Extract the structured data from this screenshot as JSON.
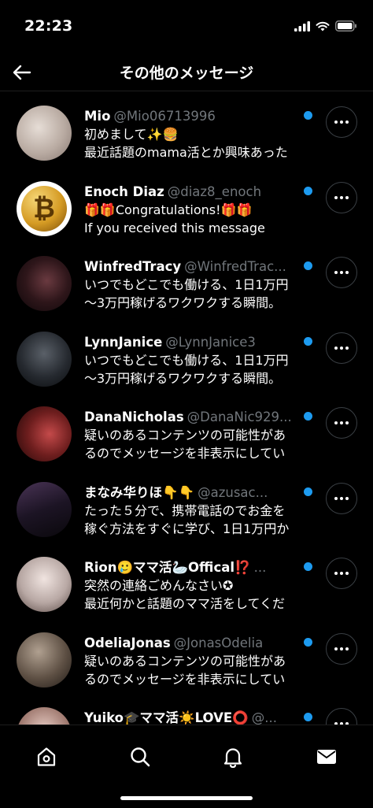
{
  "status_bar": {
    "time": "22:23"
  },
  "header": {
    "title": "その他のメッセージ"
  },
  "conversations": [
    {
      "name": "Mio",
      "handle": "@Mio06713996",
      "line1": "初めまして✨🍔",
      "line2": "最近話題のmama活とか興味あった",
      "avatar_colors": [
        "#d9cfc8",
        "#a8978d"
      ]
    },
    {
      "name": "Enoch Diaz",
      "handle": "@diaz8_enoch",
      "line1": "🎁🎁Congratulations!🎁🎁",
      "line2": "If you received this message",
      "avatar_colors": [
        "#f0c44a",
        "#8a5a0c"
      ],
      "avatar_glyph": "₿"
    },
    {
      "name": "WinfredTracy",
      "handle": "@WinfredTrac...",
      "line1": "いつでもどこでも働ける、1日1万円",
      "line2": "～3万円稼げるワクワクする瞬間。",
      "avatar_colors": [
        "#4a2a2e",
        "#120c10"
      ]
    },
    {
      "name": "LynnJanice",
      "handle": "@LynnJanice3",
      "line1": "いつでもどこでも働ける、1日1万円",
      "line2": "～3万円稼げるワクワクする瞬間。",
      "avatar_colors": [
        "#3a4048",
        "#101216"
      ]
    },
    {
      "name": "DanaNicholas",
      "handle": "@DanaNic929...",
      "line1": "疑いのあるコンテンツの可能性があ",
      "line2": "るのでメッセージを非表示にしてい",
      "avatar_colors": [
        "#8e2a2a",
        "#2a0c0c"
      ]
    },
    {
      "name": "まなみ华りほ👇👇",
      "handle": "@azusac...",
      "line1": "たった５分で、携帯電話のでお金を",
      "line2": "稼ぐ方法をすぐに学び、1日1万円か",
      "avatar_colors": [
        "#3a2a44",
        "#0c0a12"
      ]
    },
    {
      "name": "Rion🥲ママ活🦢Offical⁉️",
      "handle": "...",
      "line1": "突然の連絡ごめんなさい✪",
      "line2": "最近何かと話題のママ活をしてくだ",
      "avatar_colors": [
        "#e8dcd8",
        "#7a6a66"
      ]
    },
    {
      "name": "OdeliaJonas",
      "handle": "@JonasOdelia",
      "line1": "疑いのあるコンテンツの可能性があ",
      "line2": "るのでメッセージを非表示にしてい",
      "avatar_colors": [
        "#8a7a6a",
        "#2e2620"
      ]
    },
    {
      "name": "Yuiko🎓ママ活☀️LOVE⭕",
      "handle": "@...",
      "line1": "",
      "line2": "",
      "avatar_colors": [
        "#d8b8b0",
        "#6a4a44"
      ]
    }
  ],
  "tabbar": {
    "tabs": [
      "home",
      "search",
      "notifications",
      "messages"
    ]
  },
  "colors": {
    "accent": "#1d9bf0",
    "background": "#000000",
    "secondary_text": "#71767b"
  }
}
